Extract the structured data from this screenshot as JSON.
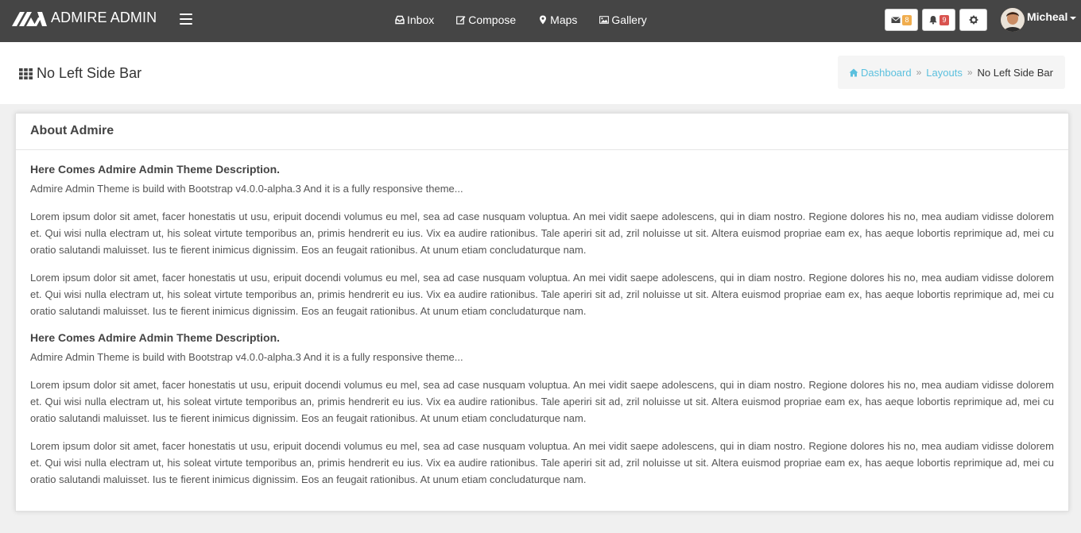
{
  "navbar": {
    "brand": "ADMIRE ADMIN",
    "links": [
      {
        "label": "Inbox",
        "icon": "inbox-icon"
      },
      {
        "label": "Compose",
        "icon": "edit-icon"
      },
      {
        "label": "Maps",
        "icon": "map-marker-icon"
      },
      {
        "label": "Gallery",
        "icon": "image-icon"
      }
    ],
    "messages_count": "8",
    "notifications_count": "9",
    "user_name": "Micheal",
    "colors": {
      "bg": "#454545",
      "badge_warning": "#f0ad4e",
      "badge_danger": "#d9534f"
    }
  },
  "header": {
    "title": "No Left Side Bar",
    "breadcrumb": {
      "home": "Dashboard",
      "section": "Layouts",
      "current": "No Left Side Bar"
    }
  },
  "card": {
    "title": "About Admire",
    "sections": [
      {
        "heading": "Here Comes Admire Admin Theme Description.",
        "intro": "Admire Admin Theme is build with Bootstrap v4.0.0-alpha.3 And it is a fully responsive theme...",
        "paragraphs": [
          "Lorem ipsum dolor sit amet, facer honestatis ut usu, eripuit docendi volumus eu mel, sea ad case nusquam voluptua. An mei vidit saepe adolescens, qui in diam nostro. Regione dolores his no, mea audiam vidisse dolorem et. Qui wisi nulla electram ut, his soleat virtute temporibus an, primis hendrerit eu ius. Vix ea audire rationibus. Tale aperiri sit ad, zril noluisse ut sit. Altera euismod propriae eam ex, has aeque lobortis reprimique ad, mei cu oratio salutandi maluisset. Ius te fierent inimicus dignissim. Eos an feugait rationibus. At unum etiam concludaturque nam.",
          "Lorem ipsum dolor sit amet, facer honestatis ut usu, eripuit docendi volumus eu mel, sea ad case nusquam voluptua. An mei vidit saepe adolescens, qui in diam nostro. Regione dolores his no, mea audiam vidisse dolorem et. Qui wisi nulla electram ut, his soleat virtute temporibus an, primis hendrerit eu ius. Vix ea audire rationibus. Tale aperiri sit ad, zril noluisse ut sit. Altera euismod propriae eam ex, has aeque lobortis reprimique ad, mei cu oratio salutandi maluisset. Ius te fierent inimicus dignissim. Eos an feugait rationibus. At unum etiam concludaturque nam."
        ]
      },
      {
        "heading": "Here Comes Admire Admin Theme Description.",
        "intro": "Admire Admin Theme is build with Bootstrap v4.0.0-alpha.3 And it is a fully responsive theme...",
        "paragraphs": [
          "Lorem ipsum dolor sit amet, facer honestatis ut usu, eripuit docendi volumus eu mel, sea ad case nusquam voluptua. An mei vidit saepe adolescens, qui in diam nostro. Regione dolores his no, mea audiam vidisse dolorem et. Qui wisi nulla electram ut, his soleat virtute temporibus an, primis hendrerit eu ius. Vix ea audire rationibus. Tale aperiri sit ad, zril noluisse ut sit. Altera euismod propriae eam ex, has aeque lobortis reprimique ad, mei cu oratio salutandi maluisset. Ius te fierent inimicus dignissim. Eos an feugait rationibus. At unum etiam concludaturque nam.",
          "Lorem ipsum dolor sit amet, facer honestatis ut usu, eripuit docendi volumus eu mel, sea ad case nusquam voluptua. An mei vidit saepe adolescens, qui in diam nostro. Regione dolores his no, mea audiam vidisse dolorem et. Qui wisi nulla electram ut, his soleat virtute temporibus an, primis hendrerit eu ius. Vix ea audire rationibus. Tale aperiri sit ad, zril noluisse ut sit. Altera euismod propriae eam ex, has aeque lobortis reprimique ad, mei cu oratio salutandi maluisset. Ius te fierent inimicus dignissim. Eos an feugait rationibus. At unum etiam concludaturque nam."
        ]
      }
    ]
  }
}
